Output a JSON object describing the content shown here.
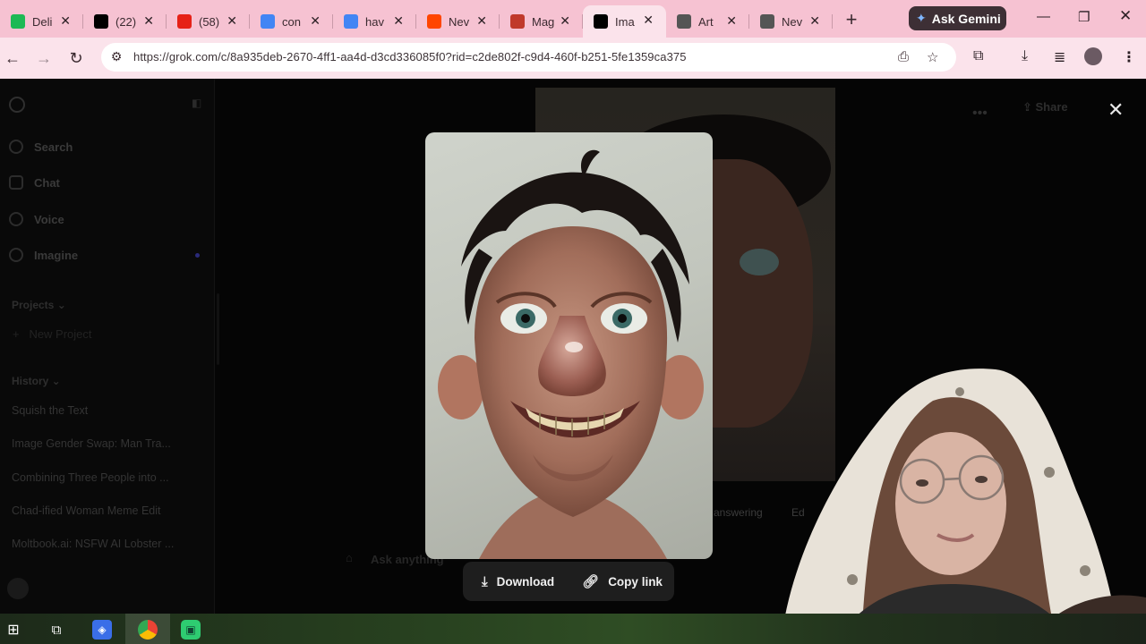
{
  "browser": {
    "tabs": [
      {
        "title": "Deli",
        "favicon": "green-k-icon",
        "color": "#1db954"
      },
      {
        "title": "(22)",
        "favicon": "x-logo-icon",
        "color": "#000000"
      },
      {
        "title": "(58)",
        "favicon": "youtube-icon",
        "color": "#e62117"
      },
      {
        "title": "con",
        "favicon": "google-icon",
        "color": "#4285f4"
      },
      {
        "title": "hav",
        "favicon": "google-icon",
        "color": "#4285f4"
      },
      {
        "title": "Nev",
        "favicon": "reddit-icon",
        "color": "#ff4500"
      },
      {
        "title": "Mag",
        "favicon": "sp-icon",
        "color": "#c0392b"
      },
      {
        "title": "Ima",
        "favicon": "grok-icon",
        "color": "#000000",
        "active": true
      },
      {
        "title": "Art",
        "favicon": "openai-icon",
        "color": "#555555"
      },
      {
        "title": "Nev",
        "favicon": "chrome-icon",
        "color": "#555555"
      }
    ],
    "ask_gemini": "Ask Gemini",
    "url": "https://grok.com/c/8a935deb-2670-4ff1-aa4d-d3cd336085f0?rid=c2de802f-c9d4-460f-b251-5fe1359ca375"
  },
  "sidebar": {
    "nav": [
      {
        "label": "Search",
        "icon": "search-icon"
      },
      {
        "label": "Chat",
        "icon": "chat-icon"
      },
      {
        "label": "Voice",
        "icon": "voice-icon"
      },
      {
        "label": "Imagine",
        "icon": "imagine-icon"
      }
    ],
    "projects_label": "Projects",
    "new_project": "New Project",
    "history_label": "History",
    "history": [
      "Squish the Text",
      "Image Gender Swap: Man Tra...",
      "Combining Three People into ...",
      "Chad-ified Woman Meme Edit",
      "Moltbook.ai: NSFW AI Lobster ..."
    ]
  },
  "header": {
    "share_label": "Share"
  },
  "background_chat": {
    "chip_left": "answering",
    "chip_right": "Ed",
    "input_placeholder": "Ask anything"
  },
  "viewer": {
    "download_label": "Download",
    "copy_link_label": "Copy link"
  },
  "colors": {
    "tabstrip": "#f6c2d2",
    "toolbar": "#fbe3eb",
    "page_bg": "#050505",
    "action_bar": "#1e1e1e"
  }
}
